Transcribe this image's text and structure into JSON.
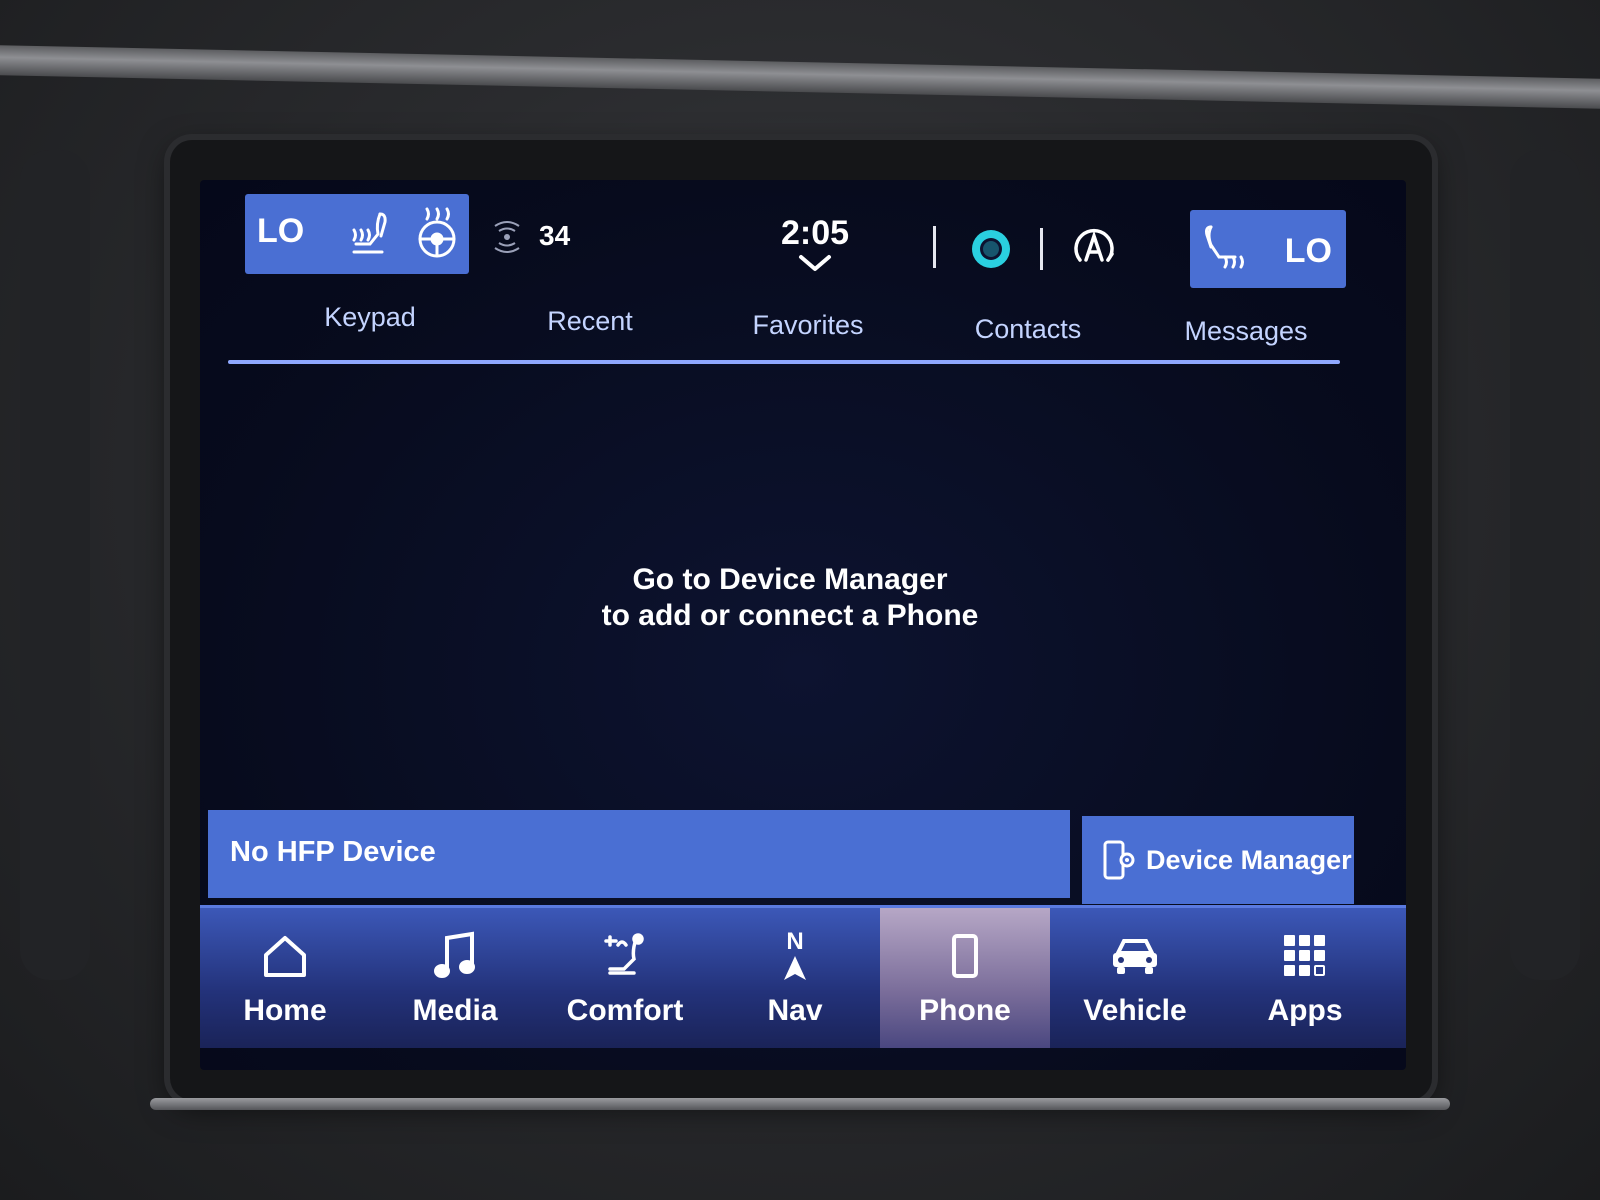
{
  "status_bar": {
    "left_climate_label": "LO",
    "right_climate_label": "LO",
    "sirius_icon": "siriusxm-icon",
    "outside_temp": "34",
    "time": "2:05"
  },
  "tabs": [
    {
      "label": "Keypad"
    },
    {
      "label": "Recent"
    },
    {
      "label": "Favorites"
    },
    {
      "label": "Contacts"
    },
    {
      "label": "Messages"
    }
  ],
  "message": {
    "line1": "Go to Device Manager",
    "line2": "to add or connect a Phone"
  },
  "hfp_status": "No HFP Device",
  "device_manager_label": "Device Manager",
  "bottom_nav": [
    {
      "label": "Home",
      "icon": "home-icon"
    },
    {
      "label": "Media",
      "icon": "music-note-icon"
    },
    {
      "label": "Comfort",
      "icon": "seat-icon"
    },
    {
      "label": "Nav",
      "icon": "compass-icon",
      "icon_text": "N"
    },
    {
      "label": "Phone",
      "icon": "phone-icon",
      "active": true
    },
    {
      "label": "Vehicle",
      "icon": "car-icon"
    },
    {
      "label": "Apps",
      "icon": "apps-grid-icon"
    }
  ],
  "colors": {
    "accent_blue": "#4a6fd3",
    "tab_text": "#c4d4ff",
    "screen_bg": "#070b1d",
    "alexa_ring": "#2ad0e0"
  }
}
